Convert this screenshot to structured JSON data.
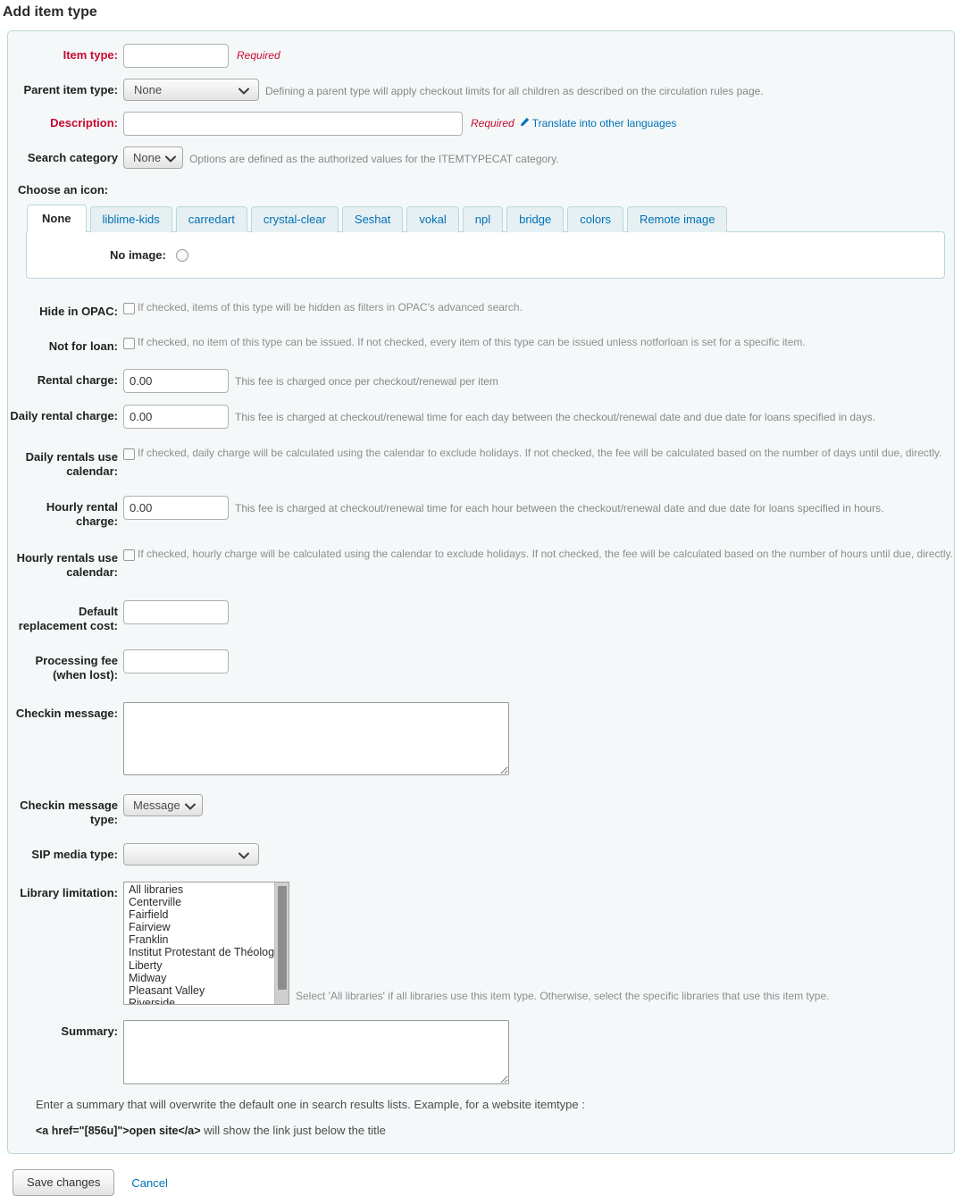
{
  "page": {
    "title": "Add item type"
  },
  "form": {
    "item_type": {
      "label": "Item type:",
      "value": "",
      "required_note": "Required"
    },
    "parent_item_type": {
      "label": "Parent item type:",
      "selected": "None",
      "hint": "Defining a parent type will apply checkout limits for all children as described on the circulation rules page."
    },
    "description": {
      "label": "Description:",
      "value": "",
      "required_note": "Required",
      "translate_link": "Translate into other languages"
    },
    "search_category": {
      "label": "Search category",
      "selected": "None",
      "hint": "Options are defined as the authorized values for the ITEMTYPECAT category."
    },
    "choose_icon": {
      "label": "Choose an icon:",
      "tabs": [
        {
          "label": "None",
          "active": true
        },
        {
          "label": "liblime-kids",
          "active": false
        },
        {
          "label": "carredart",
          "active": false
        },
        {
          "label": "crystal-clear",
          "active": false
        },
        {
          "label": "Seshat",
          "active": false
        },
        {
          "label": "vokal",
          "active": false
        },
        {
          "label": "npl",
          "active": false
        },
        {
          "label": "bridge",
          "active": false
        },
        {
          "label": "colors",
          "active": false
        },
        {
          "label": "Remote image",
          "active": false
        }
      ],
      "no_image_label": "No image:"
    },
    "hide_in_opac": {
      "label": "Hide in OPAC:",
      "checked": false,
      "hint": "If checked, items of this type will be hidden as filters in OPAC's advanced search."
    },
    "not_for_loan": {
      "label": "Not for loan:",
      "checked": false,
      "hint": "If checked, no item of this type can be issued. If not checked, every item of this type can be issued unless notforloan is set for a specific item."
    },
    "rental_charge": {
      "label": "Rental charge:",
      "value": "0.00",
      "hint": "This fee is charged once per checkout/renewal per item"
    },
    "daily_rental_charge": {
      "label": "Daily rental charge:",
      "value": "0.00",
      "hint": "This fee is charged at checkout/renewal time for each day between the checkout/renewal date and due date for loans specified in days."
    },
    "daily_rentals_use_calendar": {
      "label": "Daily rentals use calendar:",
      "checked": false,
      "hint": "If checked, daily charge will be calculated using the calendar to exclude holidays. If not checked, the fee will be calculated based on the number of days until due, directly."
    },
    "hourly_rental_charge": {
      "label": "Hourly rental charge:",
      "value": "0.00",
      "hint": "This fee is charged at checkout/renewal time for each hour between the checkout/renewal date and due date for loans specified in hours."
    },
    "hourly_rentals_use_calendar": {
      "label": "Hourly rentals use calendar:",
      "checked": false,
      "hint": "If checked, hourly charge will be calculated using the calendar to exclude holidays. If not checked, the fee will be calculated based on the number of hours until due, directly."
    },
    "default_replacement_cost": {
      "label": "Default replacement cost:",
      "value": ""
    },
    "processing_fee": {
      "label": "Processing fee (when lost):",
      "value": ""
    },
    "checkin_message": {
      "label": "Checkin message:",
      "value": ""
    },
    "checkin_message_type": {
      "label": "Checkin message type:",
      "selected": "Message"
    },
    "sip_media_type": {
      "label": "SIP media type:",
      "selected": ""
    },
    "library_limitation": {
      "label": "Library limitation:",
      "options": [
        "All libraries",
        "Centerville",
        "Fairfield",
        "Fairview",
        "Franklin",
        "Institut Protestant de Théologie",
        "Liberty",
        "Midway",
        "Pleasant Valley",
        "Riverside"
      ],
      "hint": "Select 'All libraries' if all libraries use this item type. Otherwise, select the specific libraries that use this item type."
    },
    "summary": {
      "label": "Summary:",
      "value": "",
      "note_line1": "Enter a summary that will overwrite the default one in search results lists. Example, for a website itemtype :",
      "note_code": "<a href=\"[856u]\">open site</a>",
      "note_line2_rest": " will show the link just below the title"
    }
  },
  "footer": {
    "save_label": "Save changes",
    "cancel_label": "Cancel"
  },
  "colors": {
    "required": "#c60c30",
    "link": "#0070b8",
    "fieldset_border": "#b9d8d9",
    "fieldset_bg": "#f4f8f9",
    "tab_inactive_bg": "#e6f0f2"
  }
}
